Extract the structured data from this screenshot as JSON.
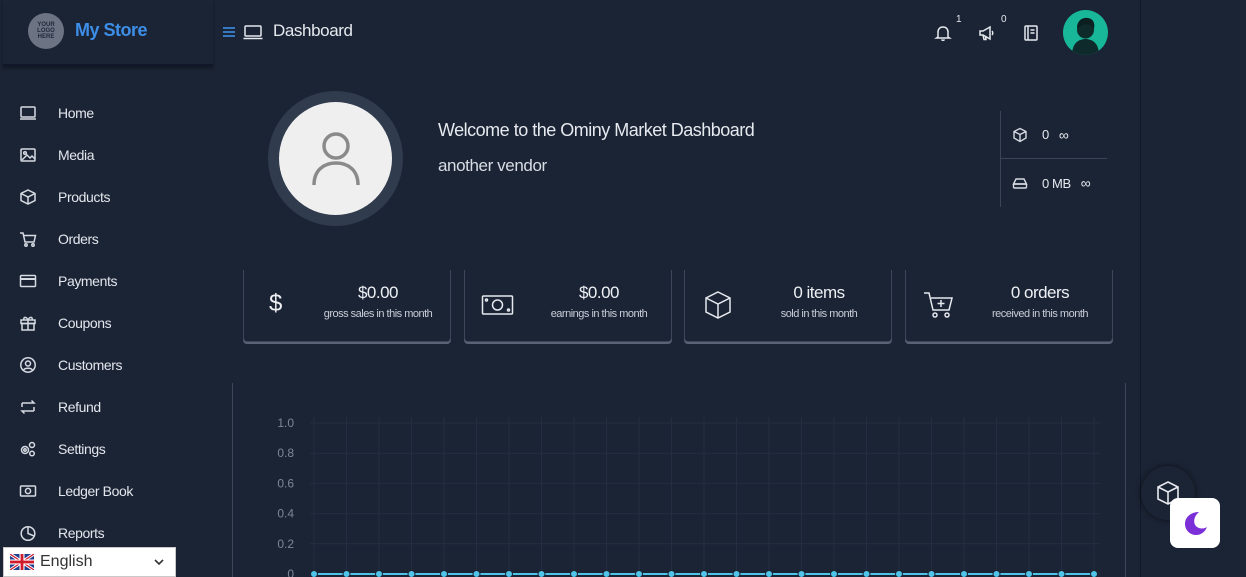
{
  "brand": {
    "logo_text": "YOUR LOGO HERE",
    "name": "My Store"
  },
  "header": {
    "title": "Dashboard",
    "notifications_count": "1",
    "announcements_count": "0"
  },
  "sidebar": {
    "items": [
      {
        "label": "Home",
        "icon": "monitor-icon"
      },
      {
        "label": "Media",
        "icon": "image-icon"
      },
      {
        "label": "Products",
        "icon": "cube-icon"
      },
      {
        "label": "Orders",
        "icon": "cart-icon"
      },
      {
        "label": "Payments",
        "icon": "credit-card-icon"
      },
      {
        "label": "Coupons",
        "icon": "gift-icon"
      },
      {
        "label": "Customers",
        "icon": "user-circle-icon"
      },
      {
        "label": "Refund",
        "icon": "refund-icon"
      },
      {
        "label": "Settings",
        "icon": "gears-icon"
      },
      {
        "label": "Ledger Book",
        "icon": "money-icon"
      },
      {
        "label": "Reports",
        "icon": "pie-chart-icon"
      }
    ]
  },
  "language": {
    "selected": "English"
  },
  "profile": {
    "welcome": "Welcome to the Ominy Market Dashboard",
    "vendor": "another vendor"
  },
  "quota": {
    "products": "0",
    "products_limit": "∞",
    "storage": "0 MB",
    "storage_limit": "∞"
  },
  "stats": [
    {
      "value": "$0.00",
      "label": "gross sales in this month",
      "icon": "dollar-icon"
    },
    {
      "value": "$0.00",
      "label": "earnings in this month",
      "icon": "money-icon"
    },
    {
      "value": "0 items",
      "label": "sold in this month",
      "icon": "cube-icon"
    },
    {
      "value": "0 orders",
      "label": "received in this month",
      "icon": "cart-plus-icon"
    }
  ],
  "chart_data": {
    "type": "line",
    "yticks": [
      "1.0",
      "0.8",
      "0.6",
      "0.4",
      "0.2",
      "0"
    ],
    "ylim": [
      0,
      1
    ],
    "series": [
      {
        "values": [
          0,
          0,
          0,
          0,
          0,
          0,
          0,
          0,
          0,
          0,
          0,
          0,
          0,
          0,
          0,
          0,
          0,
          0,
          0,
          0,
          0,
          0,
          0,
          0,
          0
        ],
        "color": "#4fc3e8"
      }
    ],
    "grid": true
  },
  "colors": {
    "accent": "#3d8ee8",
    "background": "#1b2435",
    "avatar": "#18b79a",
    "moon": "#7b2fd6"
  }
}
